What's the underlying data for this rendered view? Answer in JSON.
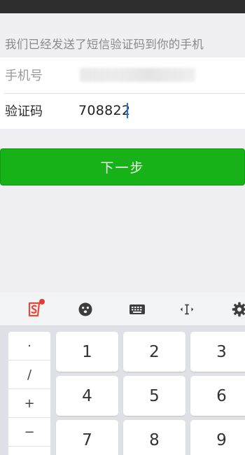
{
  "notice": "我们已经发送了短信验证码到你的手机",
  "form": {
    "phone_label": "手机号",
    "code_label": "验证码",
    "code_value": "708822"
  },
  "next_button_label": "下一步",
  "keyboard": {
    "symbols": [
      "·",
      "/",
      "+",
      "−"
    ],
    "digits": [
      "1",
      "2",
      "3",
      "4",
      "5",
      "6",
      "7",
      "8",
      "9"
    ]
  },
  "colors": {
    "accent_green": "#17b217",
    "caret_blue": "#1a73e8"
  }
}
